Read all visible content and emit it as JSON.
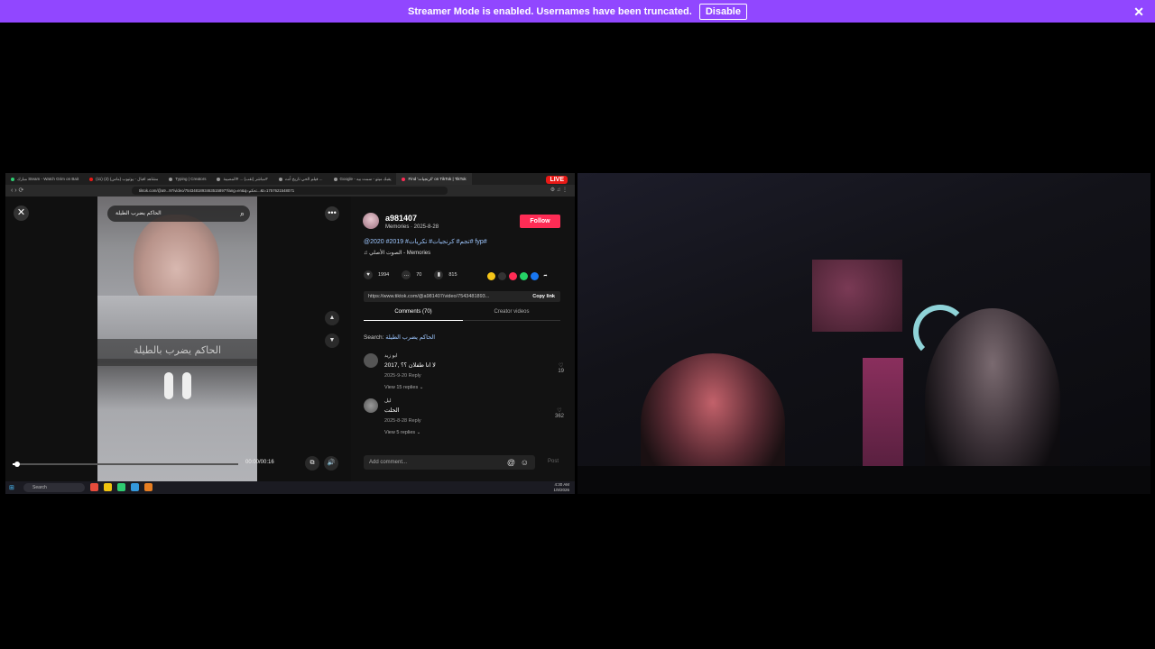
{
  "banner": {
    "message": "Streamer Mode is enabled. Usernames have been truncated.",
    "disable_label": "Disable",
    "close_glyph": "✕"
  },
  "browser": {
    "tabs": [
      {
        "label": "مبارك Steam - Watch Grim on Bait",
        "color": "#2ecc71"
      },
      {
        "label": "(11) مشاهد اقبال - يوتيوب (ماس) (2)",
        "color": "#e91916"
      },
      {
        "label": "Typing | Creators",
        "color": "#999999"
      },
      {
        "label": "مباشر (تقب) ... #المصيبة#",
        "color": "#999999"
      },
      {
        "label": "فيلم الحي تاريخ أنت ...",
        "color": "#999999"
      },
      {
        "label": "Google - يقبك ميتو - سمت بيه",
        "color": "#999999"
      },
      {
        "label": "Find 'كرنجيات' on TikTok | TikTok",
        "color": "#fe2c55"
      }
    ],
    "live_badge": "LIVE",
    "url": "tiktok.com/@a9...97/video/7543481893463515897?lang=en&q=تحكم...&t=1757621548071",
    "nav_glyphs": "‹ › ⟳",
    "ext_glyphs": "⚙ ♫ ⋮"
  },
  "video": {
    "search_query": "الحاكم يضرب الطيلة",
    "search_icon": "⌕",
    "caption": "الحاكم يضرب بالطيلة",
    "timecode": "00:00/00:16",
    "progress_fraction": 0.02,
    "close_glyph": "✕",
    "more_glyph": "•••",
    "up_glyph": "▲",
    "down_glyph": "▼",
    "pip_glyph": "⧉",
    "volume_glyph": "🔊"
  },
  "post": {
    "username": "a981407",
    "meta": "Memories · 2025-8-28",
    "follow_label": "Follow",
    "hashtags": "@تجم# كرنجيات# تكريات# 2019# 2020# fyp#",
    "sound": "♫ الصوت الأصلي - Memories",
    "likes": "1994",
    "comments": "70",
    "saves": "815",
    "like_icon": "♥",
    "comment_icon": "…",
    "save_icon": "▮",
    "link": "https://www.tiktok.com/@a981407/video/7543481893...",
    "copy_label": "Copy link",
    "tab_comments": "Comments (70)",
    "tab_creator": "Creator videos",
    "search_prefix": "Search:",
    "search_query": "الحاكم يضرب الطيلة",
    "comments_list": [
      {
        "name": "ابو زيد",
        "text": "لا انا طفلان ؟؟ ,2017",
        "meta": "2025-9-20   Reply",
        "replies": "View 15 replies ⌄",
        "likes": "19",
        "heart": "♡"
      },
      {
        "name": "ليل",
        "text": "الحلت",
        "meta": "2025-8-28   Reply",
        "replies": "View 5 replies ⌄",
        "likes": "362",
        "heart": "♡"
      }
    ],
    "add_comment": "Add comment...",
    "mention_icon": "@",
    "emoji_icon": "☺",
    "post_label": "Post"
  },
  "taskbar": {
    "start_glyph": "⊞",
    "search_label": "Search",
    "tray_time": "4:30 AM",
    "tray_date": "1/9/2026"
  },
  "colors": {
    "banner": "#9147ff",
    "follow": "#fe2c55",
    "live": "#e91916"
  }
}
